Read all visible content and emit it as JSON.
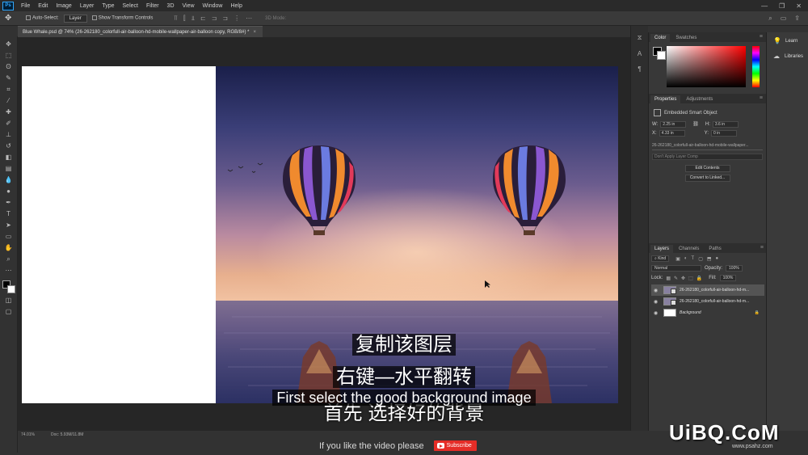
{
  "menubar": {
    "logo": "Ps",
    "items": [
      "File",
      "Edit",
      "Image",
      "Layer",
      "Type",
      "Select",
      "Filter",
      "3D",
      "View",
      "Window",
      "Help"
    ]
  },
  "options": {
    "auto_select": "Auto-Select:",
    "layer_select": "Layer",
    "transform_controls": "Show Transform Controls",
    "mode_3d": "3D Mode:"
  },
  "document": {
    "tab_title": "Blue Whale.psd @ 74% (26-262180_colorfull-air-balloon-hd-mobile-wallpaper-air-balloon copy, RGB/8#) *",
    "zoom": "74.01%",
    "doc_info": "Doc: 5.93M/11.8M"
  },
  "subtitles": {
    "line1": "复制该图层",
    "line2": "右键—水平翻转",
    "english": "First select the good background image",
    "line3": "首先 选择好的背景"
  },
  "promo": {
    "text": "If you like the video please",
    "subscribe": "Subscribe"
  },
  "color_panel": {
    "tab_color": "Color",
    "tab_swatches": "Swatches"
  },
  "properties": {
    "tab_properties": "Properties",
    "tab_adjustments": "Adjustments",
    "object_type": "Embedded Smart Object",
    "w_label": "W:",
    "w_value": "2.25 in",
    "h_label": "H:",
    "h_value": "3.6 in",
    "x_label": "X:",
    "x_value": "4.33 in",
    "y_label": "Y:",
    "y_value": "0 in",
    "file_name": "26-262180_colorfull-air-balloon-hd-mobile-wallpaper...",
    "layer_comp": "Don't Apply Layer Comp",
    "edit_contents": "Edit Contents",
    "convert_linked": "Convert to Linked..."
  },
  "layers": {
    "tab_layers": "Layers",
    "tab_channels": "Channels",
    "tab_paths": "Paths",
    "kind": "Kind",
    "blend_mode": "Normal",
    "opacity_label": "Opacity:",
    "opacity_value": "100%",
    "lock_label": "Lock:",
    "fill_label": "Fill:",
    "fill_value": "100%",
    "items": [
      {
        "name": "26-262180_colorfull-air-balloon-hd-m..."
      },
      {
        "name": "26-262180_colorfull-air-balloon-hd-m..."
      },
      {
        "name": "Background"
      }
    ]
  },
  "right_panel": {
    "learn": "Learn",
    "libraries": "Libraries"
  },
  "watermark": {
    "logo": "UiBQ.CoM",
    "url": "www.psahz.com"
  }
}
